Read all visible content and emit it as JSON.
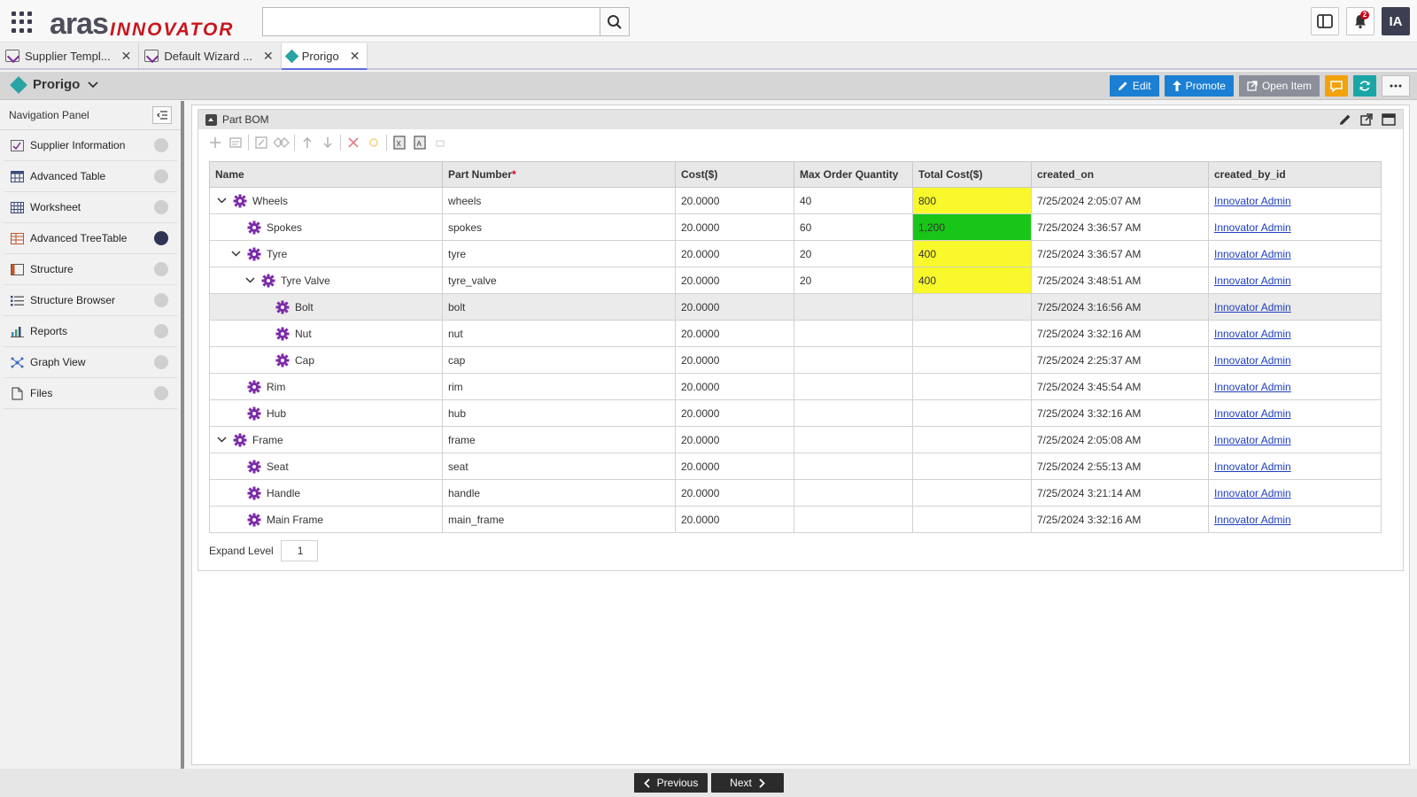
{
  "app": {
    "logo_primary": "aras",
    "logo_secondary": "INNOVATOR",
    "search_value": "",
    "notification_count": "2",
    "user_initials": "IA"
  },
  "tabs": [
    {
      "label": "Supplier Templ...",
      "active": false
    },
    {
      "label": "Default Wizard ...",
      "active": false
    },
    {
      "label": "Prorigo",
      "active": true
    }
  ],
  "item": {
    "title": "Prorigo",
    "actions": {
      "edit": "Edit",
      "promote": "Promote",
      "open_item": "Open Item"
    }
  },
  "nav": {
    "title": "Navigation Panel",
    "items": [
      {
        "label": "Supplier Information",
        "icon": "form-icon",
        "active": false
      },
      {
        "label": "Advanced Table",
        "icon": "table-icon",
        "active": false
      },
      {
        "label": "Worksheet",
        "icon": "worksheet-icon",
        "active": false
      },
      {
        "label": "Advanced TreeTable",
        "icon": "treetable-icon",
        "active": true
      },
      {
        "label": "Structure",
        "icon": "structure-icon",
        "active": false
      },
      {
        "label": "Structure Browser",
        "icon": "list-icon",
        "active": false
      },
      {
        "label": "Reports",
        "icon": "chart-icon",
        "active": false
      },
      {
        "label": "Graph View",
        "icon": "graph-icon",
        "active": false
      },
      {
        "label": "Files",
        "icon": "file-icon",
        "active": false
      }
    ]
  },
  "bom": {
    "title": "Part BOM",
    "columns": [
      "Name",
      "Part Number",
      "Cost($)",
      "Max Order Quantity",
      "Total Cost($)",
      "created_on",
      "created_by_id"
    ],
    "rows": [
      {
        "level": 0,
        "expanded": true,
        "name": "Wheels",
        "part": "wheels",
        "cost": "20.0000",
        "max": "40",
        "total": "800",
        "hl": "yellow",
        "created": "7/25/2024 2:05:07 AM",
        "by": "Innovator Admin"
      },
      {
        "level": 1,
        "expanded": null,
        "name": "Spokes",
        "part": "spokes",
        "cost": "20.0000",
        "max": "60",
        "total": "1,200",
        "hl": "green",
        "created": "7/25/2024 3:36:57 AM",
        "by": "Innovator Admin"
      },
      {
        "level": 1,
        "expanded": true,
        "name": "Tyre",
        "part": "tyre",
        "cost": "20.0000",
        "max": "20",
        "total": "400",
        "hl": "yellow",
        "created": "7/25/2024 3:36:57 AM",
        "by": "Innovator Admin"
      },
      {
        "level": 2,
        "expanded": true,
        "name": "Tyre Valve",
        "part": "tyre_valve",
        "cost": "20.0000",
        "max": "20",
        "total": "400",
        "hl": "yellow",
        "created": "7/25/2024 3:48:51 AM",
        "by": "Innovator Admin"
      },
      {
        "level": 3,
        "expanded": null,
        "name": "Bolt",
        "part": "bolt",
        "cost": "20.0000",
        "max": "",
        "total": "",
        "hl": "",
        "created": "7/25/2024 3:16:56 AM",
        "by": "Innovator Admin",
        "selected": true
      },
      {
        "level": 3,
        "expanded": null,
        "name": "Nut",
        "part": "nut",
        "cost": "20.0000",
        "max": "",
        "total": "",
        "hl": "",
        "created": "7/25/2024 3:32:16 AM",
        "by": "Innovator Admin"
      },
      {
        "level": 3,
        "expanded": null,
        "name": "Cap",
        "part": "cap",
        "cost": "20.0000",
        "max": "",
        "total": "",
        "hl": "",
        "created": "7/25/2024 2:25:37 AM",
        "by": "Innovator Admin"
      },
      {
        "level": 1,
        "expanded": null,
        "name": "Rim",
        "part": "rim",
        "cost": "20.0000",
        "max": "",
        "total": "",
        "hl": "",
        "created": "7/25/2024 3:45:54 AM",
        "by": "Innovator Admin"
      },
      {
        "level": 1,
        "expanded": null,
        "name": "Hub",
        "part": "hub",
        "cost": "20.0000",
        "max": "",
        "total": "",
        "hl": "",
        "created": "7/25/2024 3:32:16 AM",
        "by": "Innovator Admin"
      },
      {
        "level": 0,
        "expanded": true,
        "name": "Frame",
        "part": "frame",
        "cost": "20.0000",
        "max": "",
        "total": "",
        "hl": "",
        "created": "7/25/2024 2:05:08 AM",
        "by": "Innovator Admin"
      },
      {
        "level": 1,
        "expanded": null,
        "name": "Seat",
        "part": "seat",
        "cost": "20.0000",
        "max": "",
        "total": "",
        "hl": "",
        "created": "7/25/2024 2:55:13 AM",
        "by": "Innovator Admin"
      },
      {
        "level": 1,
        "expanded": null,
        "name": "Handle",
        "part": "handle",
        "cost": "20.0000",
        "max": "",
        "total": "",
        "hl": "",
        "created": "7/25/2024 3:21:14 AM",
        "by": "Innovator Admin"
      },
      {
        "level": 1,
        "expanded": null,
        "name": "Main Frame",
        "part": "main_frame",
        "cost": "20.0000",
        "max": "",
        "total": "",
        "hl": "",
        "created": "7/25/2024 3:32:16 AM",
        "by": "Innovator Admin"
      }
    ],
    "expand_level_label": "Expand Level",
    "expand_level_value": "1"
  },
  "footer": {
    "previous": "Previous",
    "next": "Next"
  },
  "colors": {
    "accent_blue": "#1b7fd4",
    "highlight_yellow": "#f8f82a",
    "highlight_green": "#18c618",
    "gear_purple": "#7b2aa8",
    "link": "#1f3fbf"
  }
}
